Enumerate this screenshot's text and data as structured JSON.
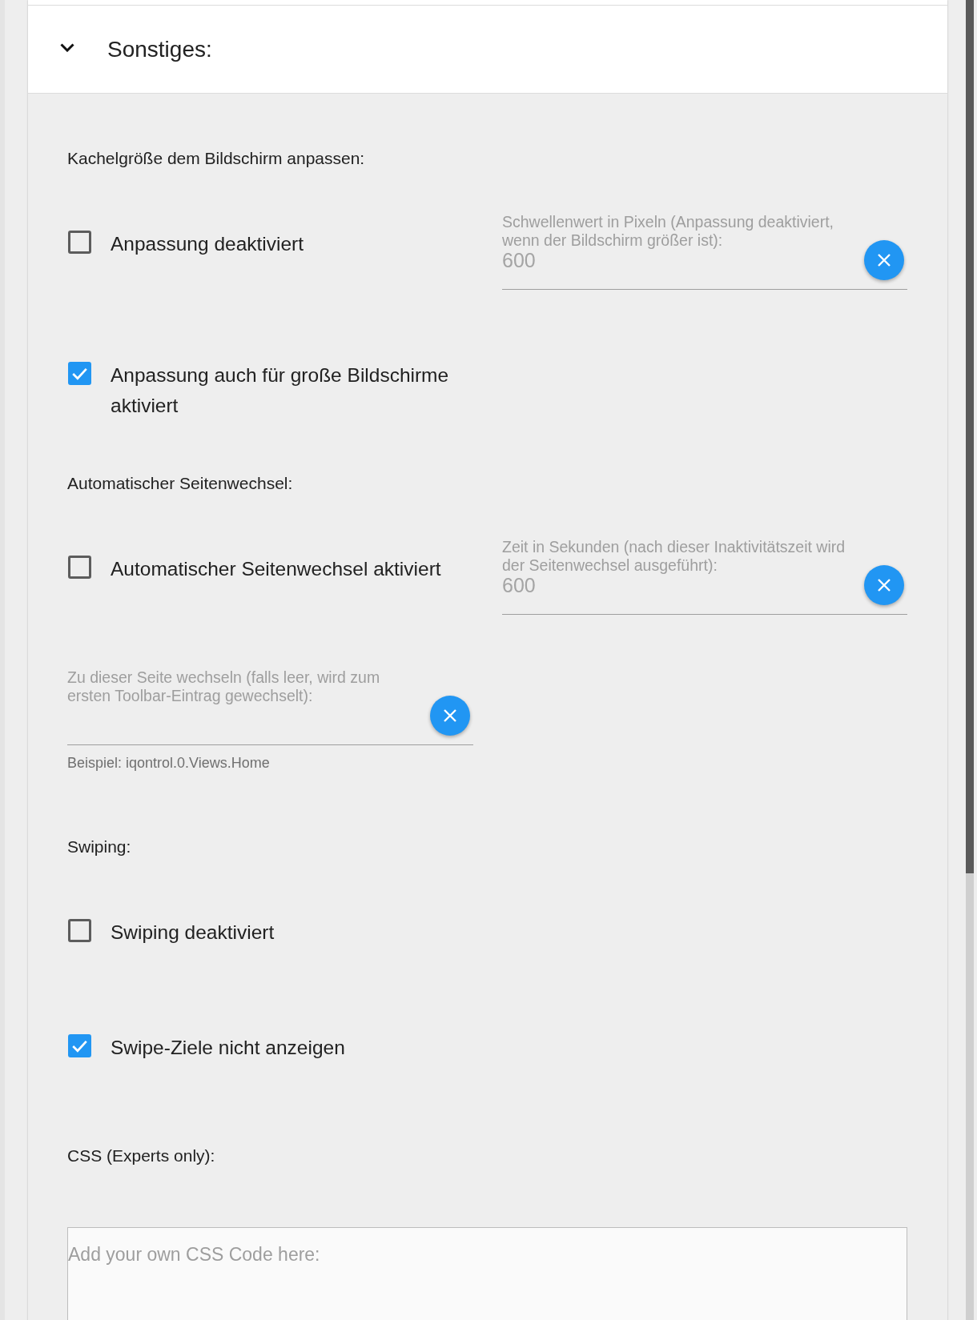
{
  "section": {
    "title": "Sonstiges:",
    "expanded": true
  },
  "items": [
    {
      "kind": "heading",
      "text": "Kachelgröße dem Bildschirm anpassen:"
    },
    {
      "kind": "checkbox",
      "label": "Anpassung deaktiviert",
      "checked": false,
      "field": {
        "label": "Schwellenwert in Pixeln (Anpassung deaktiviert, wenn der Bildschirm größer ist):",
        "placeholder": "600"
      }
    },
    {
      "kind": "checkbox",
      "label": "Anpassung auch für große Bildschirme aktiviert",
      "checked": true
    },
    {
      "kind": "heading",
      "text": "Automatischer Seitenwechsel:"
    },
    {
      "kind": "checkbox",
      "label": "Automatischer Seitenwechsel aktiviert",
      "checked": false,
      "field": {
        "label": "Zeit in Sekunden (nach dieser Inaktivitätszeit wird der Seitenwechsel ausgeführt):",
        "placeholder": "600"
      }
    },
    {
      "kind": "field",
      "label": "Zu dieser Seite wechseln (falls leer, wird zum ersten Toolbar-Eintrag gewechselt):",
      "helper": "Beispiel: iqontrol.0.Views.Home"
    },
    {
      "kind": "heading",
      "text": "Swiping:"
    },
    {
      "kind": "checkbox",
      "label": "Swiping deaktiviert",
      "checked": false
    },
    {
      "kind": "checkbox",
      "label": "Swipe-Ziele nicht anzeigen",
      "checked": true
    },
    {
      "kind": "heading",
      "text": "CSS (Experts only):"
    },
    {
      "kind": "textarea",
      "placeholder": "Add your own CSS Code here:"
    }
  ]
}
